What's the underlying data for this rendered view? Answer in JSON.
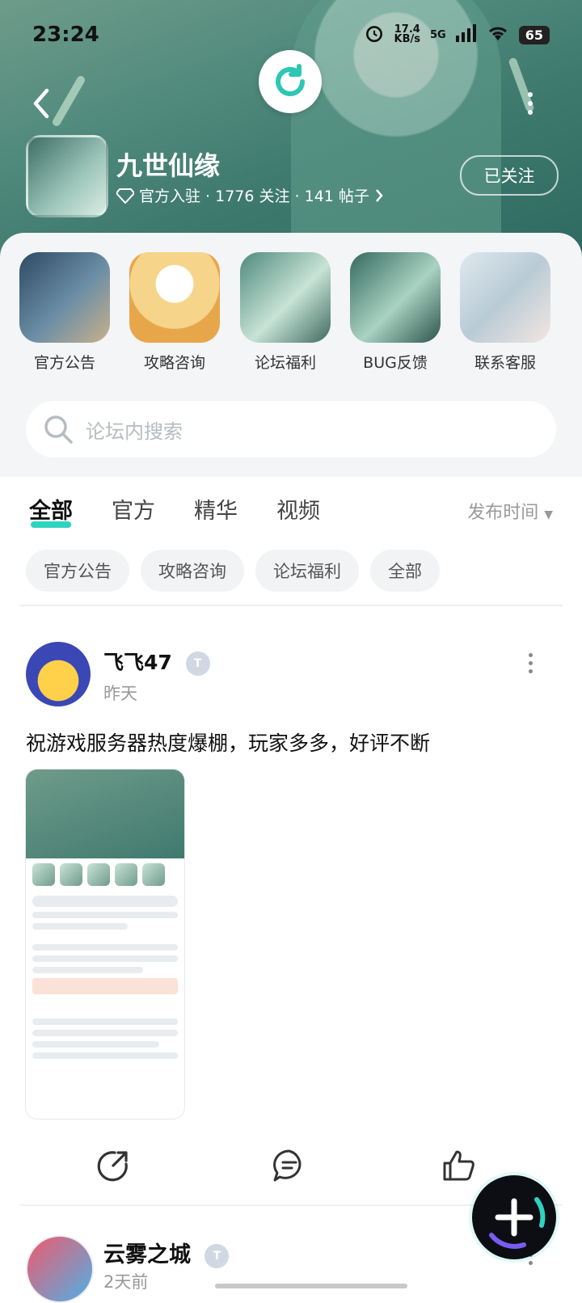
{
  "status_bar": {
    "time": "23:24",
    "net_speed": "17.4\nKB/s",
    "network": "5G",
    "battery": "65"
  },
  "header": {
    "game_title": "九世仙缘",
    "subtitle": "官方入驻 · 1776 关注 · 141 帖子",
    "follow_label": "已关注"
  },
  "quick_entries": [
    {
      "label": "官方公告"
    },
    {
      "label": "攻略咨询"
    },
    {
      "label": "论坛福利"
    },
    {
      "label": "BUG反馈"
    },
    {
      "label": "联系客服"
    }
  ],
  "search": {
    "placeholder": "论坛内搜索"
  },
  "tabs": [
    {
      "label": "全部",
      "active": true
    },
    {
      "label": "官方"
    },
    {
      "label": "精华"
    },
    {
      "label": "视频"
    }
  ],
  "sort_label": "发布时间",
  "chips": [
    "官方公告",
    "攻略咨询",
    "论坛福利",
    "全部"
  ],
  "posts": [
    {
      "author": "飞飞47",
      "time": "昨天",
      "content": "祝游戏服务器热度爆棚，玩家多多，好评不断"
    },
    {
      "author": "云雾之城",
      "time": "2天前"
    }
  ],
  "colors": {
    "accent": "#2dd4c0",
    "header_bg": "#4f8a7c"
  }
}
